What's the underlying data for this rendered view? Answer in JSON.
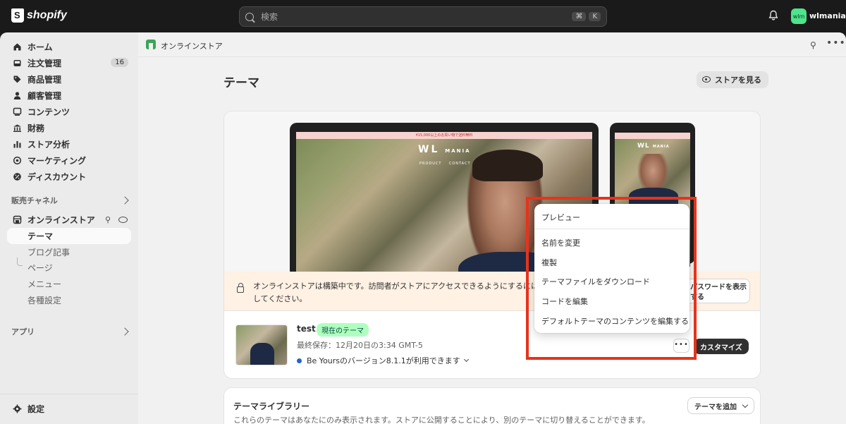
{
  "topbar": {
    "brand": "shopify",
    "search_placeholder": "検索",
    "shortcut_keys": [
      "⌘",
      "K"
    ],
    "avatar_initials": "wlm",
    "store_name": "wlmania"
  },
  "sidebar": {
    "items": [
      {
        "label": "ホーム",
        "icon": "home-icon"
      },
      {
        "label": "注文管理",
        "icon": "inbox-icon",
        "badge": "16"
      },
      {
        "label": "商品管理",
        "icon": "tag-icon"
      },
      {
        "label": "顧客管理",
        "icon": "person-icon"
      },
      {
        "label": "コンテンツ",
        "icon": "content-icon"
      },
      {
        "label": "財務",
        "icon": "bank-icon"
      },
      {
        "label": "ストア分析",
        "icon": "bar-chart-icon"
      },
      {
        "label": "マーケティング",
        "icon": "target-icon"
      },
      {
        "label": "ディスカウント",
        "icon": "discount-icon"
      }
    ],
    "sales_channels_label": "販売チャネル",
    "online_store_label": "オンラインストア",
    "online_store_sub": [
      "テーマ",
      "ブログ記事",
      "ページ",
      "メニュー",
      "各種設定"
    ],
    "apps_label": "アプリ",
    "settings_label": "設定"
  },
  "header": {
    "section": "オンラインストア"
  },
  "main": {
    "title": "テーマ",
    "view_store_label": "ストアを見る",
    "preview": {
      "brand": "WL",
      "brand_suffix": "MANIA",
      "nav_items": [
        "PRODUCT",
        "CONTACT"
      ],
      "announcement": "¥15,000以上のお買い物で送料無料"
    },
    "banner": {
      "message": "オンラインストアは構築中です。訪問者がストアにアクセスできるようにするには",
      "message_line2": "してください。",
      "button_label_line1": "パスワードを表示",
      "button_label_line2": "する"
    },
    "current_theme": {
      "name": "test",
      "badge": "現在のテーマ",
      "last_saved": "最終保存：12月20日の3:34 GMT-5",
      "update_notice": "Be Yoursのバージョン8.1.1が利用できます",
      "more_label": "•••",
      "customize_label": "カスタマイズ"
    },
    "library": {
      "title": "テーマライブラリー",
      "description": "これらのテーマはあなたにのみ表示されます。ストアに公開することにより、別のテーマに切り替えることができます。",
      "add_theme_label": "テーマを追加"
    }
  },
  "menu": {
    "items": [
      "プレビュー",
      "名前を変更",
      "複製",
      "テーマファイルをダウンロード",
      "コードを編集",
      "デフォルトテーマのコンテンツを編集する"
    ]
  },
  "colors": {
    "highlight": "#e8321c",
    "badge_green": "#affebf",
    "avatar": "#4de48c",
    "banner_bg": "#fff1e3"
  }
}
